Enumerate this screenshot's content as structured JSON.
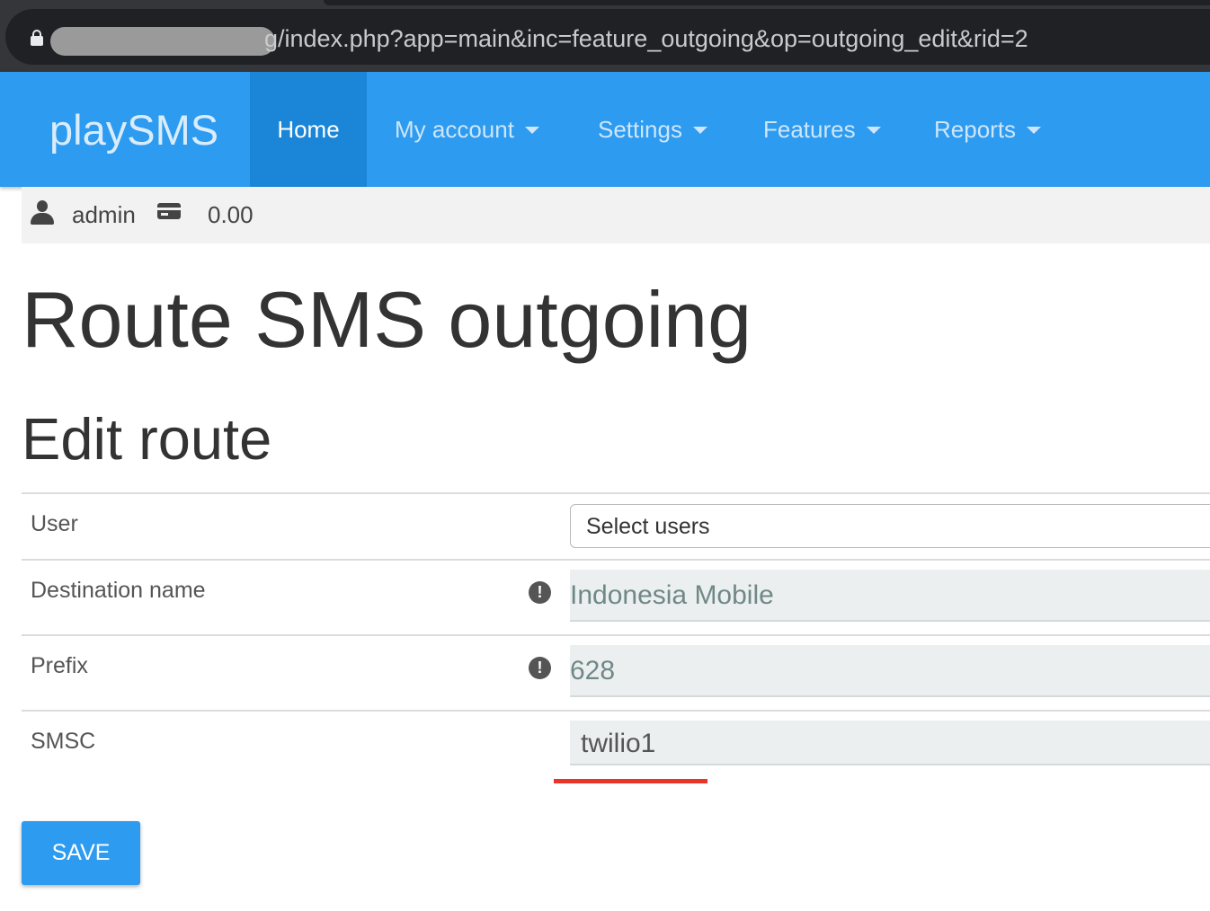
{
  "browser": {
    "url_visible": "g/index.php?app=main&inc=feature_outgoing&op=outgoing_edit&rid=2"
  },
  "navbar": {
    "brand": "playSMS",
    "items": [
      {
        "label": "Home",
        "active": true,
        "dropdown": false
      },
      {
        "label": "My account",
        "active": false,
        "dropdown": true
      },
      {
        "label": "Settings",
        "active": false,
        "dropdown": true
      },
      {
        "label": "Features",
        "active": false,
        "dropdown": true
      },
      {
        "label": "Reports",
        "active": false,
        "dropdown": true
      }
    ],
    "color": "#2d9bf0",
    "active_color": "#1b86d8"
  },
  "user_bar": {
    "username": "admin",
    "balance": "0.00"
  },
  "page": {
    "title": "Route SMS outgoing",
    "section": "Edit route"
  },
  "form": {
    "user": {
      "label": "User",
      "placeholder": "Select users"
    },
    "destination_name": {
      "label": "Destination name",
      "value": "Indonesia Mobile",
      "info": "!"
    },
    "prefix": {
      "label": "Prefix",
      "value": "628",
      "info": "!"
    },
    "smsc": {
      "label": "SMSC",
      "value": "twilio1"
    },
    "save_label": "SAVE"
  },
  "annotation_color": "#e8352a"
}
